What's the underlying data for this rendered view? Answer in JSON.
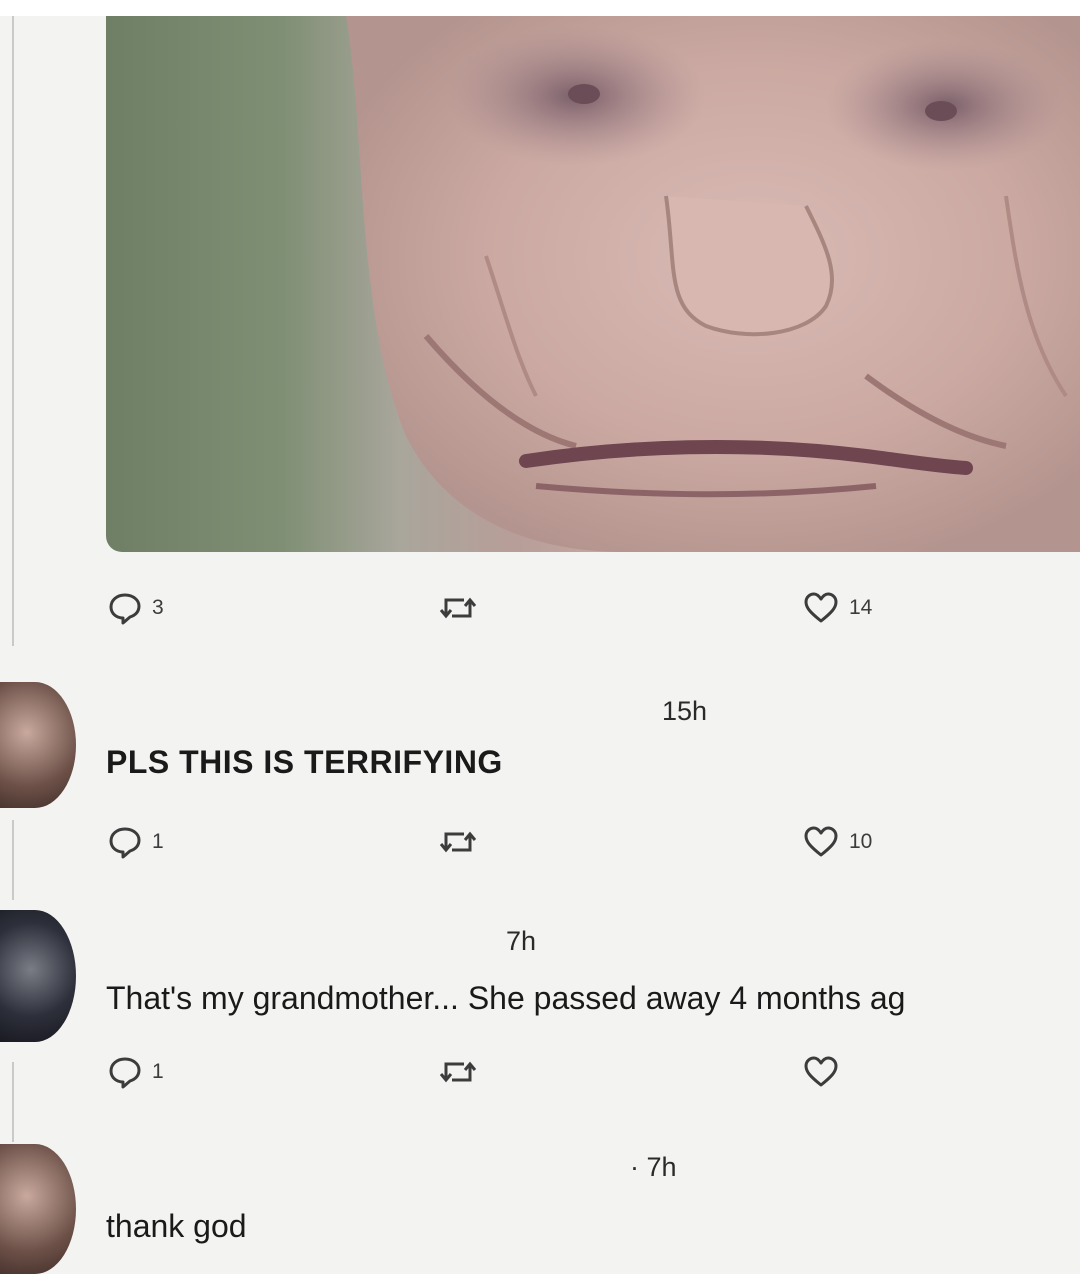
{
  "post": {
    "image_alt": "close-up photo of an elderly woman's face",
    "actions": {
      "comments": "3",
      "likes": "14"
    }
  },
  "replies": [
    {
      "time": "15h",
      "text": "PLS THIS IS TERRIFYING",
      "comments": "1",
      "likes": "10"
    },
    {
      "time": "7h",
      "text": "That's my grandmother... She passed away 4 months ag",
      "comments": "1",
      "likes": ""
    },
    {
      "time": "· 7h",
      "text": "thank god"
    }
  ],
  "colors": {
    "background": "#f3f3f1",
    "icon": "#3c3c3c",
    "text": "#1a1a1a"
  }
}
